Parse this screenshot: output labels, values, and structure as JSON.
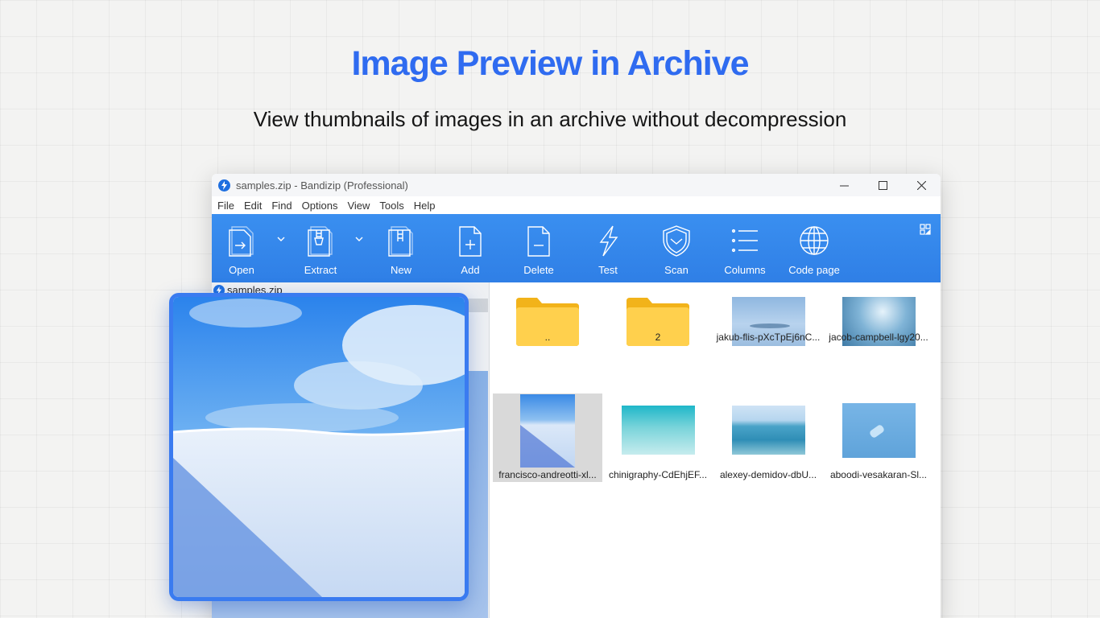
{
  "hero": {
    "title": "Image Preview in Archive",
    "subtitle": "View thumbnails of images in an archive without decompression"
  },
  "window": {
    "title": "samples.zip - Bandizip (Professional)",
    "controls": [
      "minimize-icon",
      "maximize-icon",
      "close-icon"
    ]
  },
  "menu": [
    "File",
    "Edit",
    "Find",
    "Options",
    "View",
    "Tools",
    "Help"
  ],
  "toolbar": {
    "open": "Open",
    "extract": "Extract",
    "new": "New",
    "add": "Add",
    "delete": "Delete",
    "test": "Test",
    "scan": "Scan",
    "columns": "Columns",
    "codepage": "Code page"
  },
  "tree": {
    "root": "samples.zip"
  },
  "files": [
    {
      "name": "..",
      "kind": "folder"
    },
    {
      "name": "2",
      "kind": "folder"
    },
    {
      "name": "jakub-flis-pXcTpEj6nC...",
      "kind": "image"
    },
    {
      "name": "jacob-campbell-lgy20...",
      "kind": "image"
    },
    {
      "name": "francisco-andreotti-xl...",
      "kind": "image",
      "selected": true
    },
    {
      "name": "chinigraphy-CdEhjEF...",
      "kind": "image"
    },
    {
      "name": "alexey-demidov-dbU...",
      "kind": "image"
    },
    {
      "name": "aboodi-vesakaran-Sl...",
      "kind": "image"
    }
  ],
  "colors": {
    "accent": "#2f6bf0",
    "toolbar": "#3088ec",
    "preview_border": "#3a7bf0"
  }
}
